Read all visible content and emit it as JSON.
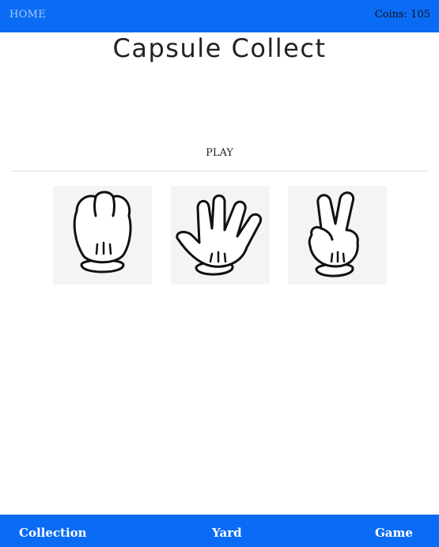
{
  "header": {
    "home_label": "HOME",
    "coins_text": "Coins: 105"
  },
  "main": {
    "title": "Capsule Collect",
    "play_label": "PLAY",
    "choices": [
      {
        "name": "rock",
        "icon": "fist-glove-icon"
      },
      {
        "name": "paper",
        "icon": "open-hand-glove-icon"
      },
      {
        "name": "scissors",
        "icon": "peace-sign-glove-icon"
      }
    ]
  },
  "bottom_nav": {
    "items": [
      {
        "label": "Collection"
      },
      {
        "label": "Yard"
      },
      {
        "label": "Game"
      }
    ]
  },
  "colors": {
    "bar": "#0a6cf5",
    "home_link": "#aac9f2",
    "tile_bg": "#f4f4f4"
  }
}
